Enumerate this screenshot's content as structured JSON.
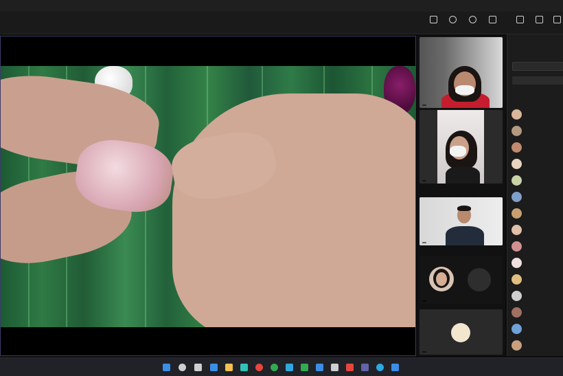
{
  "title_bar": {
    "text": ""
  },
  "toolbar": {
    "buttons": [
      {
        "label": "",
        "icon": "camera-icon"
      },
      {
        "label": "",
        "icon": "chat-icon"
      },
      {
        "label": "",
        "icon": "reactions-icon"
      },
      {
        "label": "",
        "icon": "more-icon"
      },
      {
        "label": "",
        "icon": "people-icon"
      },
      {
        "label": "",
        "icon": "mic-icon"
      },
      {
        "label": "",
        "icon": "share-icon"
      }
    ]
  },
  "participants_tiles": [
    {
      "name": "",
      "kind": "video-masked-woman"
    },
    {
      "name": "",
      "kind": "video-masked-girl"
    },
    {
      "name": "",
      "kind": "video-man-suit"
    },
    {
      "name": "",
      "kind": "avatar-woman"
    },
    {
      "name": "",
      "kind": "initials"
    },
    {
      "name": "",
      "kind": "initials"
    }
  ],
  "people_panel": {
    "heading": "",
    "search_placeholder": "",
    "button_label": "",
    "section_label": "",
    "members": [
      {
        "name": "",
        "avatar_color": "#d8b79a"
      },
      {
        "name": "",
        "avatar_color": "#b39a80"
      },
      {
        "name": "",
        "avatar_color": "#c08a70"
      },
      {
        "name": "",
        "avatar_color": "#e8d5c0"
      },
      {
        "name": "",
        "avatar_color": "#c9d2a8"
      },
      {
        "name": "",
        "avatar_color": "#7fa0c8"
      },
      {
        "name": "",
        "avatar_color": "#c8a070"
      },
      {
        "name": "",
        "avatar_color": "#e0c0a8"
      },
      {
        "name": "",
        "avatar_color": "#d09090"
      },
      {
        "name": "",
        "avatar_color": "#f0e0e0"
      },
      {
        "name": "",
        "avatar_color": "#e0c080"
      },
      {
        "name": "",
        "avatar_color": "#d0d0d0"
      },
      {
        "name": "",
        "avatar_color": "#a07060"
      },
      {
        "name": "",
        "avatar_color": "#6fa0d8"
      },
      {
        "name": "",
        "avatar_color": "#c8a080"
      }
    ]
  },
  "taskbar": {
    "icons": [
      {
        "name": "windows-start-icon",
        "color": "#3a8ee6"
      },
      {
        "name": "search-icon",
        "color": "#cfcfcf"
      },
      {
        "name": "task-view-icon",
        "color": "#cfcfcf"
      },
      {
        "name": "widgets-icon",
        "color": "#3a8ee6"
      },
      {
        "name": "chat-icon",
        "color": "#7b68ee"
      },
      {
        "name": "file-explorer-icon",
        "color": "#f2c14e"
      },
      {
        "name": "edge-icon",
        "color": "#2ec4b6"
      },
      {
        "name": "store-icon",
        "color": "#3a8ee6"
      },
      {
        "name": "teams-icon",
        "color": "#6264a7"
      },
      {
        "name": "chrome-icon",
        "color": "#e8453c"
      },
      {
        "name": "app-icon",
        "color": "#2ea8e0"
      },
      {
        "name": "app-icon",
        "color": "#34a853"
      },
      {
        "name": "app-icon",
        "color": "#3a8ee6"
      },
      {
        "name": "app-icon",
        "color": "#cfcfcf"
      },
      {
        "name": "app-icon",
        "color": "#7b68ee"
      },
      {
        "name": "app-icon",
        "color": "#e8453c"
      },
      {
        "name": "app-icon",
        "color": "#2ea8e0"
      },
      {
        "name": "app-icon",
        "color": "#3a8ee6"
      },
      {
        "name": "app-icon",
        "color": "#cfcfcf"
      }
    ],
    "clock": ""
  }
}
